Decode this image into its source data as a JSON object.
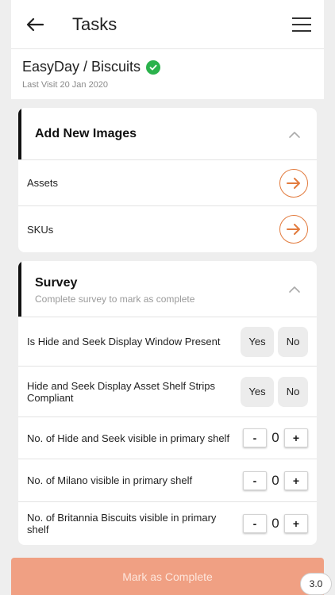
{
  "header": {
    "title": "Tasks"
  },
  "store": {
    "name": "EasyDay / Biscuits",
    "last_visit": "Last Visit 20 Jan 2020"
  },
  "images_section": {
    "title": "Add New Images",
    "items": [
      {
        "label": "Assets"
      },
      {
        "label": "SKUs"
      }
    ]
  },
  "survey": {
    "title": "Survey",
    "subtitle": "Complete survey to mark as complete",
    "yes_label": "Yes",
    "no_label": "No",
    "yes_no_questions": [
      {
        "label": "Is Hide and Seek Display Window Present"
      },
      {
        "label": "Hide and Seek Display Asset Shelf Strips Compliant"
      }
    ],
    "minus_label": "-",
    "plus_label": "+",
    "count_questions": [
      {
        "label": "No. of Hide and Seek visible in primary shelf",
        "value": "0"
      },
      {
        "label": "No. of Milano visible in primary shelf",
        "value": "0"
      },
      {
        "label": "No. of Britannia Biscuits visible in primary shelf",
        "value": "0"
      }
    ]
  },
  "footer": {
    "complete_label": "Mark as Complete",
    "version": "3.0"
  },
  "colors": {
    "accent": "#e27b3e",
    "complete_button": "#f0a083",
    "check": "#2bb24c"
  }
}
